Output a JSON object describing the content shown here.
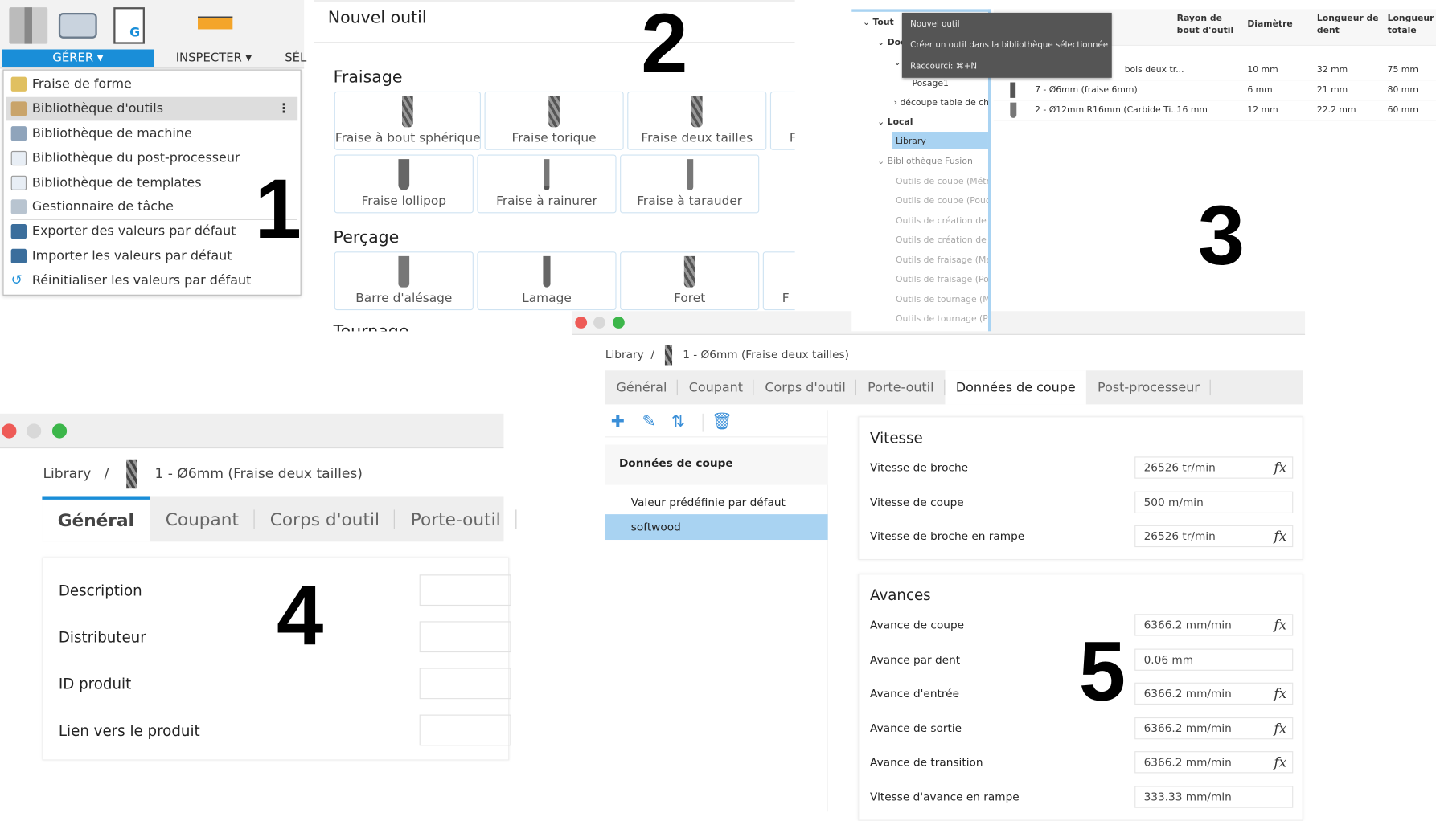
{
  "panel_numbers": [
    "1",
    "2",
    "3",
    "4",
    "5"
  ],
  "toolbar": {
    "gerer": "GÉRER ▾",
    "inspecter": "INSPECTER ▾",
    "sel": "SÉL"
  },
  "menu": {
    "items": [
      "Fraise de forme",
      "Bibliothèque d'outils",
      "Bibliothèque de machine",
      "Bibliothèque du post-processeur",
      "Bibliothèque de templates",
      "Gestionnaire de tâche",
      "Exporter des valeurs par défaut",
      "Importer les valeurs par défaut",
      "Réinitialiser les valeurs par défaut"
    ],
    "highlighted": "Bibliothèque d'outils",
    "more_icon": "⋮"
  },
  "new_tool": {
    "title": "Nouvel outil",
    "milling": {
      "heading": "Fraisage",
      "row1": [
        "Fraise à bout sphérique",
        "Fraise torique",
        "Fraise deux tailles",
        "F"
      ],
      "row2": [
        "Fraise lollipop",
        "Fraise à rainurer",
        "Fraise à tarauder"
      ]
    },
    "drilling": {
      "heading": "Perçage",
      "row": [
        "Barre d'alésage",
        "Lamage",
        "Foret",
        "F"
      ]
    },
    "turning": {
      "heading": "Tournage"
    }
  },
  "library": {
    "tree": {
      "all": "Tout",
      "doc": "Doc",
      "posage": "Posage1",
      "decoupe": "découpe table de che",
      "local": "Local",
      "library": "Library",
      "fusion": "Bibliothèque Fusion",
      "fusion_items": [
        "Outils de coupe (Métric",
        "Outils de coupe (Pouce",
        "Outils de création de pi",
        "Outils de création de pi",
        "Outils de fraisage (Mét",
        "Outils de fraisage (Pou",
        "Outils de tournage (Mé",
        "Outils de tournage (Po"
      ]
    },
    "tooltip": {
      "title": "Nouvel outil",
      "desc": "Créer un outil dans la bibliothèque sélectionnée",
      "shortcut": "Raccourci: ⌘+N"
    },
    "columns": [
      "Rayon de bout d'outil",
      "Diamètre",
      "Longueur de dent",
      "Longueur totale"
    ],
    "rows": [
      {
        "name": "bois deux tr...",
        "radius": "",
        "diameter": "10 mm",
        "flute": "32 mm",
        "total": "75 mm"
      },
      {
        "name": "7 - Ø6mm (fraise 6mm)",
        "radius": "",
        "diameter": "6 mm",
        "flute": "21 mm",
        "total": "80 mm"
      },
      {
        "name": "2 - Ø12mm R16mm (Carbide Ti...",
        "radius": "16 mm",
        "diameter": "12 mm",
        "flute": "22.2 mm",
        "total": "60 mm"
      }
    ]
  },
  "tool_window": {
    "breadcrumb_root": "Library",
    "breadcrumb_sep": "/",
    "tool_name": "1 - Ø6mm (Fraise deux tailles)",
    "tabs": [
      "Général",
      "Coupant",
      "Corps d'outil",
      "Porte-outil",
      "Données de coupe",
      "Post-processeur"
    ],
    "active_tab": "Données de coupe",
    "presets": {
      "header": "Données de coupe",
      "items": [
        "Valeur prédéfinie par défaut",
        "softwood"
      ],
      "selected": "softwood"
    },
    "speed": {
      "heading": "Vitesse",
      "fields": [
        {
          "label": "Vitesse de broche",
          "value": "26526 tr/min",
          "fx": true
        },
        {
          "label": "Vitesse de coupe",
          "value": "500 m/min",
          "fx": false
        },
        {
          "label": "Vitesse de broche en rampe",
          "value": "26526 tr/min",
          "fx": true
        }
      ]
    },
    "feeds": {
      "heading": "Avances",
      "fields": [
        {
          "label": "Avance de coupe",
          "value": "6366.2 mm/min",
          "fx": true
        },
        {
          "label": "Avance par dent",
          "value": "0.06 mm",
          "fx": false
        },
        {
          "label": "Avance d'entrée",
          "value": "6366.2 mm/min",
          "fx": true
        },
        {
          "label": "Avance de sortie",
          "value": "6366.2 mm/min",
          "fx": true
        },
        {
          "label": "Avance de transition",
          "value": "6366.2 mm/min",
          "fx": true
        },
        {
          "label": "Vitesse d'avance en rampe",
          "value": "333.33 mm/min",
          "fx": false
        }
      ]
    },
    "fx_label": "fx"
  },
  "general_window": {
    "breadcrumb_root": "Library",
    "breadcrumb_sep": "/",
    "tool_name": "1 - Ø6mm (Fraise deux tailles)",
    "tabs": [
      "Général",
      "Coupant",
      "Corps d'outil",
      "Porte-outil"
    ],
    "active_tab": "Général",
    "fields": [
      "Description",
      "Distributeur",
      "ID produit",
      "Lien vers le produit"
    ]
  },
  "colors": {
    "accent": "#1a8ed8",
    "selection": "#a9d3f2",
    "close": "#ee5b57",
    "min": "#d8d8d8",
    "max": "#3cb64a"
  }
}
